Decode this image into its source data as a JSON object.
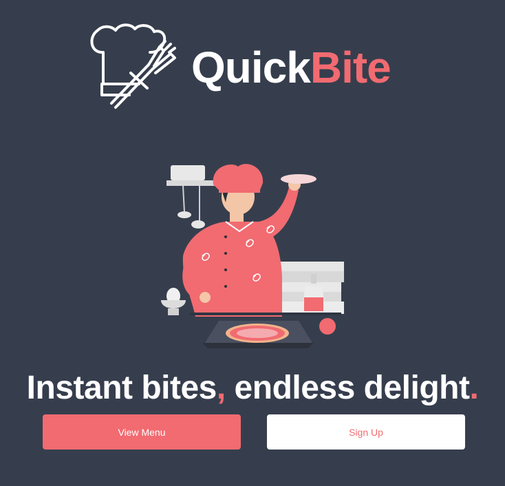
{
  "brand": {
    "part1": "Quick",
    "part2": "Bite"
  },
  "hero": {
    "tagline_1": "Instant bites",
    "tagline_comma": ",",
    "tagline_2": " endless delight",
    "tagline_period": "."
  },
  "actions": {
    "view_menu": "View Menu",
    "sign_up": "Sign Up"
  },
  "colors": {
    "background": "#363e4d",
    "accent": "#f16b71",
    "text": "#ffffff"
  },
  "icons": {
    "logo": "chef-hat-fork-icon",
    "illustration": "chef-tossing-pizza-illustration"
  }
}
